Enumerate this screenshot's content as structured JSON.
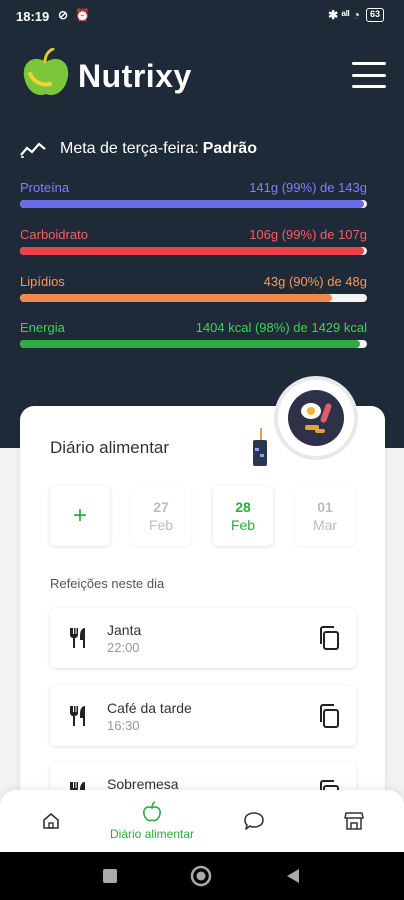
{
  "status": {
    "time": "18:19",
    "left_icons": "⊘ ⏰",
    "right_icons": "✱ ᵃˡˡ ◔",
    "battery": "63"
  },
  "app": {
    "name": "Nutrixy"
  },
  "goal": {
    "label": "Meta de terça-feira:",
    "value": "Padrão"
  },
  "macros": [
    {
      "name": "Proteína",
      "value": "141g (99%) de 143g",
      "percent": 99,
      "color": "#6b6de8"
    },
    {
      "name": "Carboidrato",
      "value": "106g (99%) de 107g",
      "percent": 99,
      "color": "#e8434a"
    },
    {
      "name": "Lipídios",
      "value": "43g (90%) de 48g",
      "percent": 90,
      "color": "#f08a4b"
    },
    {
      "name": "Energia",
      "value": "1404 kcal (98%) de 1429 kcal",
      "percent": 98,
      "color": "#2eab3f"
    }
  ],
  "diary": {
    "title": "Diário alimentar",
    "add_label": "+",
    "dates": [
      {
        "day": "27",
        "month": "Feb"
      },
      {
        "day": "28",
        "month": "Feb"
      },
      {
        "day": "01",
        "month": "Mar"
      }
    ],
    "section_label": "Refeições neste dia",
    "meals": [
      {
        "name": "Janta",
        "time": "22:00"
      },
      {
        "name": "Café da tarde",
        "time": "16:30"
      },
      {
        "name": "Sobremesa",
        "time": ""
      }
    ]
  },
  "nav": {
    "active_label": "Diário alimentar"
  },
  "colors": {
    "dark": "#1f2a38",
    "accent": "#2eab3f"
  }
}
